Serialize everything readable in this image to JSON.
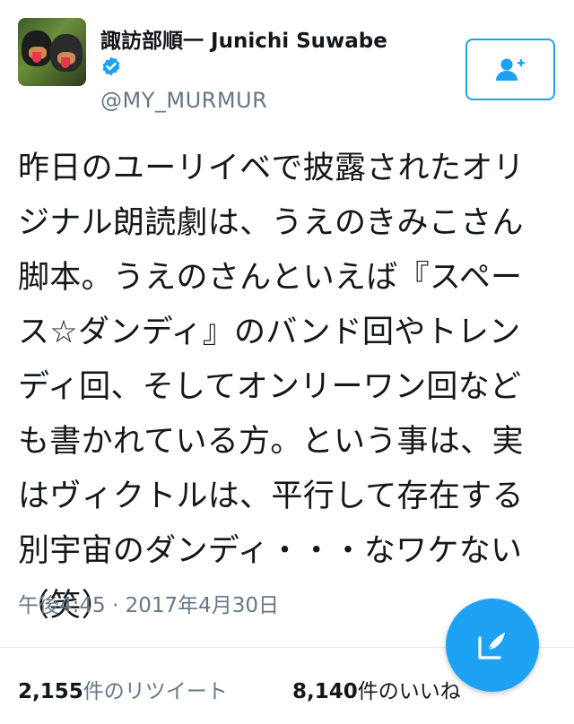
{
  "profile": {
    "display_name": "諏訪部順一 Junichi Suwabe",
    "handle": "@MY_MURMUR",
    "verified": true
  },
  "follow_button": {
    "icon": "add-user-icon",
    "color": "#1da1f2"
  },
  "tweet": {
    "lines": [
      "昨日のユーリイベで披露されたオリ",
      "ジナル朗読劇は、うえのきみこさん",
      "脚本。うえのさんといえば『スペー",
      "ス☆ダンディ』のバンド回やトレン",
      "ディ回、そしてオンリーワン回など",
      "も書かれている方。という事は、実",
      "はヴィクトルは、平行して存在する",
      "別宇宙のダンディ・・・なワケない",
      "（笑）"
    ],
    "timestamp": "午後4:45 · 2017年4月30日"
  },
  "stats": {
    "retweets_count": "2,155",
    "retweets_label": "件のリツイート",
    "likes_count": "8,140",
    "likes_label": "件のいいね"
  },
  "compose_button": {
    "icon": "compose-tweet-icon",
    "color": "#1da1f2"
  }
}
